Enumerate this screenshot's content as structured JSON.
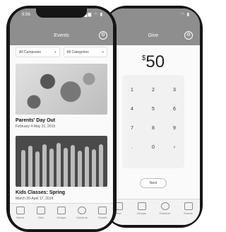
{
  "left_phone": {
    "status": {
      "time": "9:56",
      "icons": "▂▄▆ ◠ ▮"
    },
    "header": {
      "title": "Events"
    },
    "filters": [
      {
        "label": "All Campuses"
      },
      {
        "label": "All Categories"
      }
    ],
    "events": [
      {
        "title": "Parents' Day Out",
        "date": "February 4-May 31, 2019"
      },
      {
        "title": "Kids Classes: Spring",
        "date": "March 20-April 17, 2019"
      }
    ],
    "tabs": [
      {
        "label": "Home",
        "icon": "home-icon"
      },
      {
        "label": "Give",
        "icon": "give-icon"
      },
      {
        "label": "Groups",
        "icon": "groups-icon"
      },
      {
        "label": "Check-In",
        "icon": "check-in-icon"
      },
      {
        "label": "Events",
        "icon": "events-icon"
      }
    ]
  },
  "right_phone": {
    "status": {
      "icons": "◠ ▮"
    },
    "header": {
      "title": "Give"
    },
    "amount": {
      "currency": "$",
      "value": "50"
    },
    "keypad": [
      "1",
      "2",
      "3",
      "4",
      "5",
      "6",
      "7",
      "8",
      "9",
      ".",
      "0",
      "‹"
    ],
    "next_label": "Next",
    "tabs": [
      {
        "label": "Give",
        "icon": "give-icon"
      },
      {
        "label": "Groups",
        "icon": "groups-icon"
      },
      {
        "label": "Check-In",
        "icon": "check-in-icon"
      },
      {
        "label": "Events",
        "icon": "events-icon"
      }
    ]
  },
  "colors": {
    "header": "#8e8e8e",
    "frame": "#161616",
    "keypad_bg": "#f1f1f1"
  }
}
